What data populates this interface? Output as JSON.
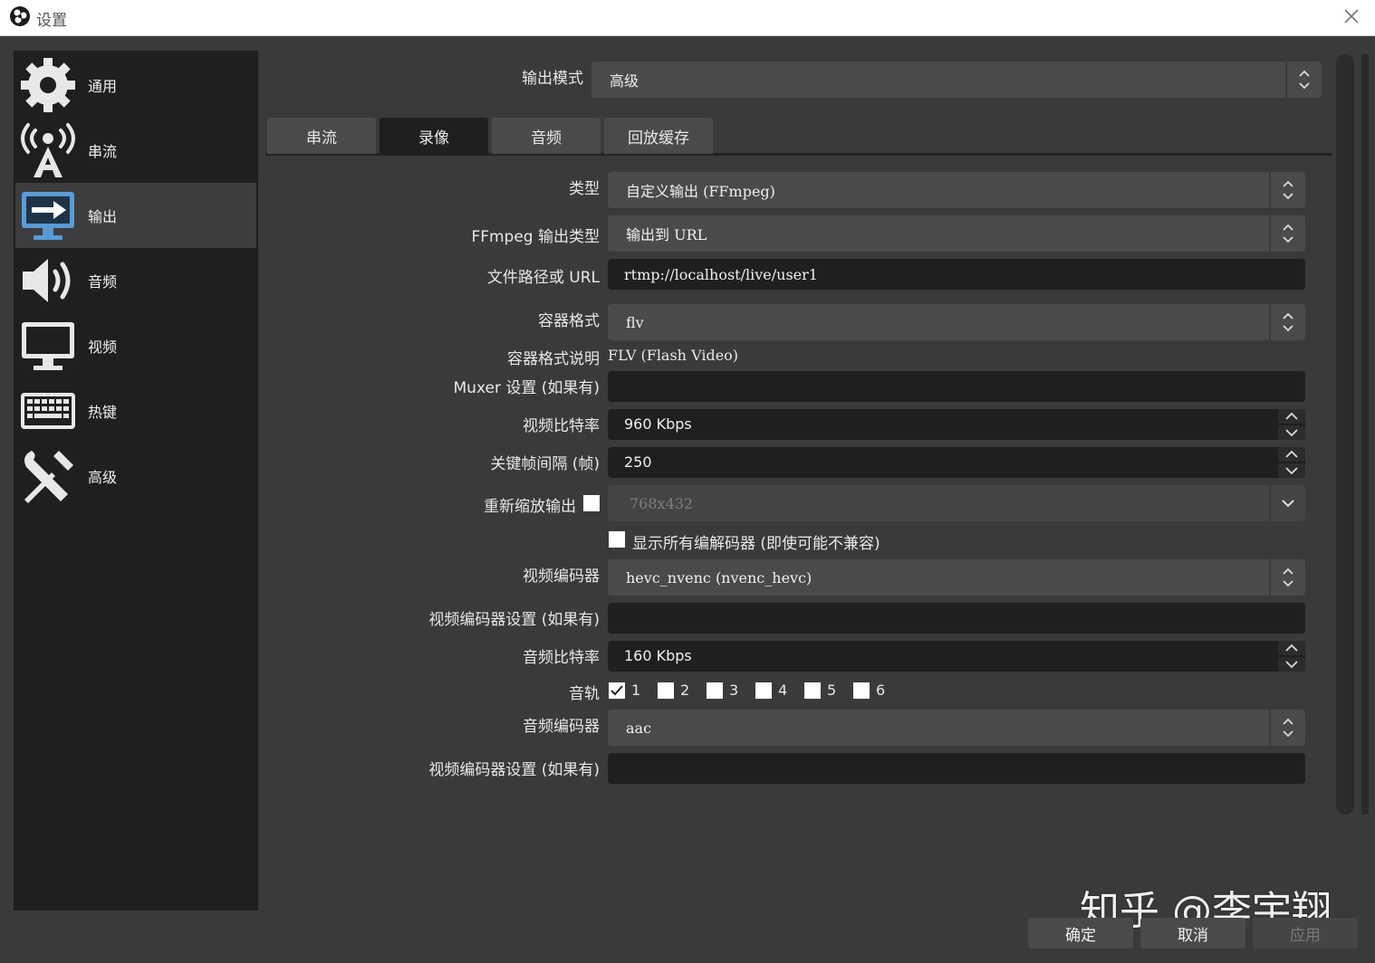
{
  "window": {
    "title": "设置"
  },
  "sidebar": {
    "items": [
      {
        "label": "通用",
        "icon": "gear-icon"
      },
      {
        "label": "串流",
        "icon": "broadcast-icon"
      },
      {
        "label": "输出",
        "icon": "monitor-arrow-icon",
        "active": true
      },
      {
        "label": "音频",
        "icon": "speaker-icon"
      },
      {
        "label": "视频",
        "icon": "monitor-icon"
      },
      {
        "label": "热键",
        "icon": "keyboard-icon"
      },
      {
        "label": "高级",
        "icon": "tools-icon"
      }
    ]
  },
  "output_mode": {
    "label": "输出模式",
    "value": "高级"
  },
  "tabs": [
    {
      "label": "串流"
    },
    {
      "label": "录像",
      "active": true
    },
    {
      "label": "音频"
    },
    {
      "label": "回放缓存"
    }
  ],
  "form": {
    "type": {
      "label": "类型",
      "value": "自定义输出 (FFmpeg)"
    },
    "ffmpeg_output_type": {
      "label": "FFmpeg 输出类型",
      "value": "输出到 URL"
    },
    "file_path_url": {
      "label": "文件路径或 URL",
      "value": "rtmp://localhost/live/user1"
    },
    "container_format": {
      "label": "容器格式",
      "value": "flv"
    },
    "container_desc": {
      "label": "容器格式说明",
      "value": "FLV (Flash Video)"
    },
    "muxer_settings": {
      "label": "Muxer 设置 (如果有)",
      "value": ""
    },
    "video_bitrate": {
      "label": "视频比特率",
      "value": "960 Kbps"
    },
    "keyframe_interval": {
      "label": "关键帧间隔 (帧)",
      "value": "250"
    },
    "rescale_output": {
      "label": "重新缩放输出",
      "value": "768x432",
      "checked": false
    },
    "show_all_codecs": {
      "label": "显示所有编解码器 (即使可能不兼容)",
      "checked": false
    },
    "video_encoder": {
      "label": "视频编码器",
      "value": "hevc_nvenc (nvenc_hevc)"
    },
    "video_encoder_settings": {
      "label": "视频编码器设置 (如果有)",
      "value": ""
    },
    "audio_bitrate": {
      "label": "音频比特率",
      "value": "160 Kbps"
    },
    "audio_track": {
      "label": "音轨",
      "tracks": [
        {
          "label": "1",
          "checked": true
        },
        {
          "label": "2",
          "checked": false
        },
        {
          "label": "3",
          "checked": false
        },
        {
          "label": "4",
          "checked": false
        },
        {
          "label": "5",
          "checked": false
        },
        {
          "label": "6",
          "checked": false
        }
      ]
    },
    "audio_encoder": {
      "label": "音频编码器",
      "value": "aac"
    },
    "audio_encoder_settings": {
      "label": "视频编码器设置 (如果有)",
      "value": ""
    }
  },
  "buttons": {
    "ok": "确定",
    "cancel": "取消",
    "apply": "应用"
  },
  "watermark": "知乎 @李宇翔"
}
